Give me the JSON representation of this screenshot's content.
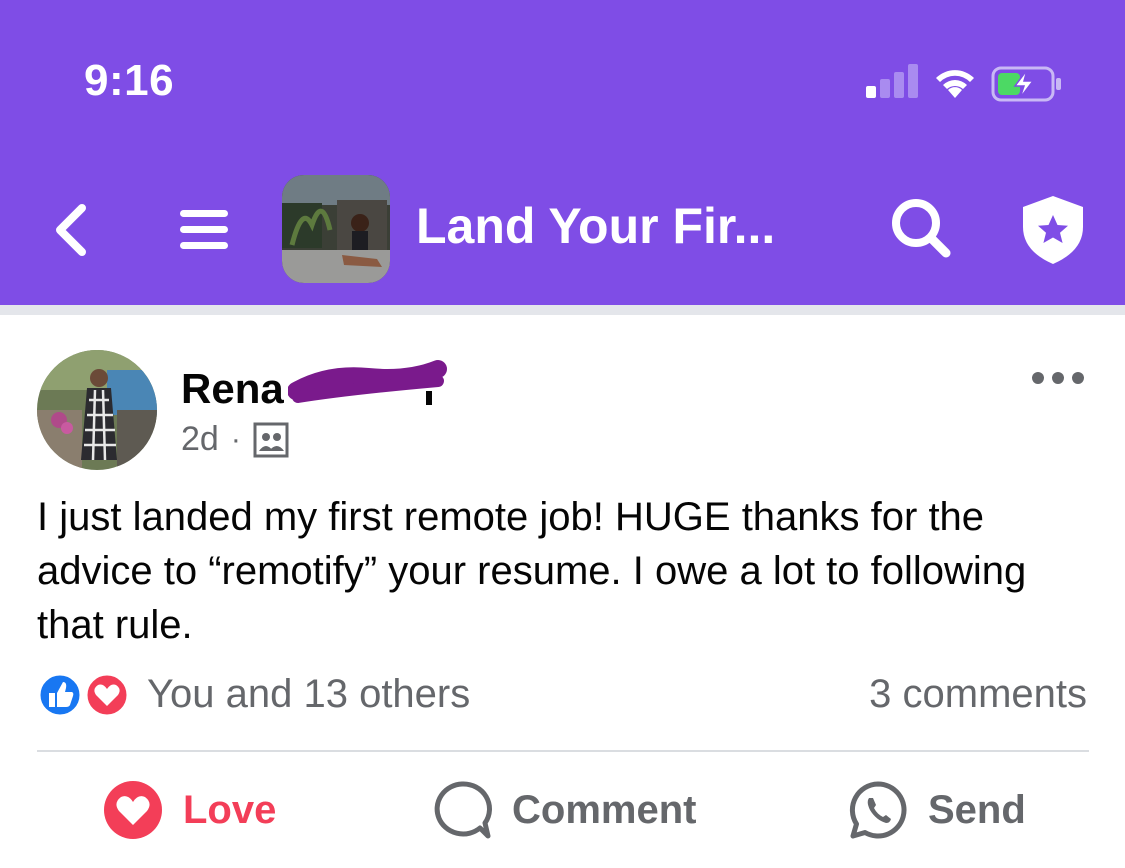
{
  "status_bar": {
    "time": "9:16",
    "signal_icon": "cellular-signal-icon",
    "wifi_icon": "wifi-icon",
    "battery_icon": "battery-charging-icon"
  },
  "header": {
    "back_icon": "chevron-left-icon",
    "menu_icon": "hamburger-menu-icon",
    "group_title": "Land Your Fir...",
    "search_icon": "search-icon",
    "shield_icon": "shield-star-icon",
    "background_color": "#7f4de6"
  },
  "post": {
    "author_name": "Rena",
    "timestamp": "2d",
    "audience_icon": "group-members-icon",
    "more_icon": "more-options-icon",
    "text": "I just landed my first remote job! HUGE thanks for the advice to “remotify” your resume. I owe a lot to following that rule.",
    "reactions": {
      "icons": [
        "like-icon",
        "love-icon"
      ],
      "summary": "You and 13 others"
    },
    "comment_count": "3 comments"
  },
  "actions": {
    "love_label": "Love",
    "comment_label": "Comment",
    "send_label": "Send",
    "love_color": "#f33e58"
  }
}
